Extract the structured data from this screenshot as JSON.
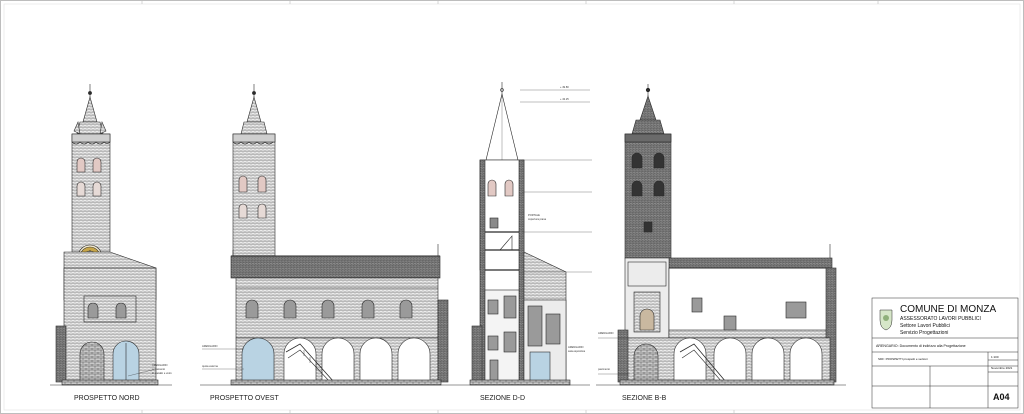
{
  "views": {
    "north": {
      "label": "PROSPETTO NORD"
    },
    "west": {
      "label": "PROSPETTO OVEST"
    },
    "section_dd": {
      "label": "SEZIONE D-D"
    },
    "section_bb": {
      "label": "SEZIONE B-B"
    }
  },
  "title_block": {
    "municipality": "COMUNE DI MONZA",
    "department": "ASSESSORATO LAVORI PUBBLICI",
    "sector": "Settore Lavori Pubblici",
    "service": "Servizio Progettazioni",
    "project": "ARENGARIO: Documento di indirizzo alla Progettazione",
    "drawing_title": "SDF: PROSPETTI prospetti e sezioni",
    "scale": "1:100",
    "date": "Novembre 2021",
    "sheet_number": "A04"
  },
  "colors": {
    "line": "#2a2a2a",
    "brick_hatch": "#555555",
    "tower_fill": "#d9d3cc",
    "clock_face": "#c7a64a",
    "glass": "#b9d3e3",
    "frame": "#bdbdbd"
  }
}
